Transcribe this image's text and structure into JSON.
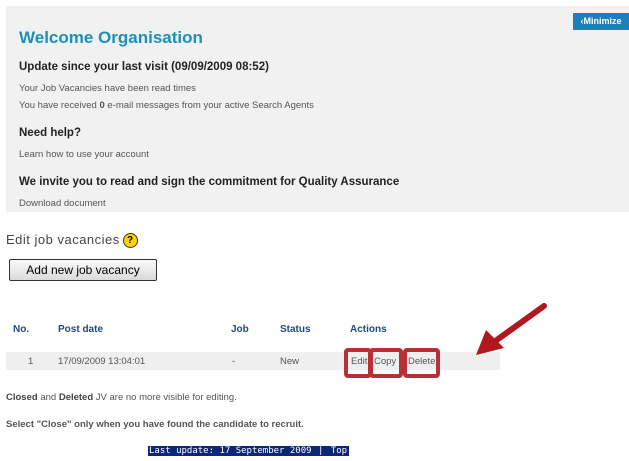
{
  "welcome": {
    "minimize_label": "‹Minimize",
    "title": "Welcome Organisation",
    "update_heading": "Update since your last visit (09/09/2009 08:52)",
    "update_line1": "Your Job Vacancies have been read times",
    "update_line2_pre": "You have received ",
    "update_line2_count": "0",
    "update_line2_post": " e-mail messages from your active Search Agents",
    "help_heading": "Need help?",
    "help_link": "Learn how to use your account",
    "qa_heading": "We invite you to read and sign the commitment for Quality Assurance",
    "qa_link": "Download document"
  },
  "page": {
    "heading": "Edit job vacancies",
    "help_icon": "?",
    "add_button": "Add new job vacancy"
  },
  "table": {
    "headers": {
      "no": "No.",
      "post_date": "Post date",
      "job": "Job",
      "status": "Status",
      "actions": "Actions"
    },
    "rows": [
      {
        "no": "1",
        "post_date": "17/09/2009 13:04:01",
        "job": "-",
        "status": "New",
        "edit": "Edit",
        "copy": "Copy",
        "delete": "Delete"
      }
    ]
  },
  "notes": {
    "closed_word": "Closed",
    "and_word": " and ",
    "deleted_word": "Deleted",
    "closed_rest": " JV are no more visible for editing.",
    "select_note": "Select \"Close\" only when you have found the candidate to recruit."
  },
  "footer": {
    "last_update": "Last update: 17 September 2009",
    "separator": " | ",
    "top": "Top"
  },
  "annotation": {
    "highlight_color": "#b83036",
    "arrow_color": "#b0171f"
  }
}
